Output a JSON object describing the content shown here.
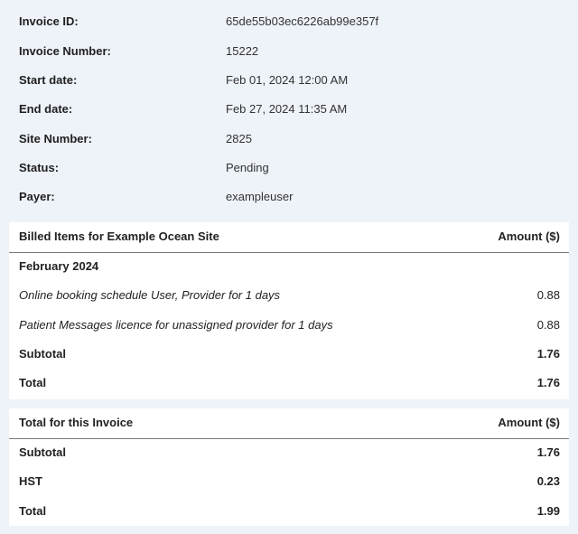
{
  "details": [
    {
      "label": "Invoice ID:",
      "value": "65de55b03ec6226ab99e357f"
    },
    {
      "label": "Invoice Number:",
      "value": "15222"
    },
    {
      "label": "Start date:",
      "value": "Feb 01, 2024 12:00 AM"
    },
    {
      "label": "End date:",
      "value": "Feb 27, 2024 11:35 AM"
    },
    {
      "label": "Site Number:",
      "value": "2825"
    },
    {
      "label": "Status:",
      "value": "Pending"
    },
    {
      "label": "Payer:",
      "value": "exampleuser"
    }
  ],
  "billed": {
    "header_left": "Billed Items for Example Ocean Site",
    "header_right": "Amount ($)",
    "month": "February 2024",
    "items": [
      {
        "description": "Online booking schedule User, Provider for 1 days",
        "amount": "0.88"
      },
      {
        "description": "Patient Messages licence for unassigned provider for 1 days",
        "amount": "0.88"
      }
    ],
    "subtotal_label": "Subtotal",
    "subtotal_value": "1.76",
    "total_label": "Total",
    "total_value": "1.76"
  },
  "invoice_total": {
    "header_left": "Total for this Invoice",
    "header_right": "Amount ($)",
    "subtotal_label": "Subtotal",
    "subtotal_value": "1.76",
    "tax_label": "HST",
    "tax_value": "0.23",
    "total_label": "Total",
    "total_value": "1.99"
  }
}
